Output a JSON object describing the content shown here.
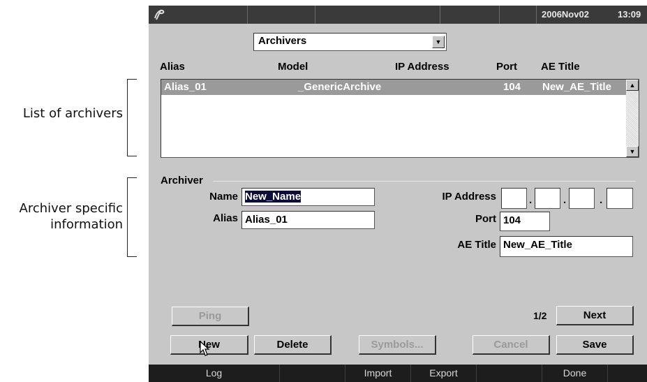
{
  "callouts": {
    "list_label": "List of archivers",
    "info_label_line1": "Archiver specific",
    "info_label_line2": "information"
  },
  "topbar": {
    "date": "2006Nov02",
    "time": "13:09",
    "logo_icon": "swirl-logo-icon"
  },
  "dropdown": {
    "selected": "Archivers"
  },
  "list": {
    "headers": [
      "Alias",
      "Model",
      "IP Address",
      "Port",
      "AE Title"
    ],
    "rows": [
      {
        "alias": "Alias_01",
        "model": "_GenericArchive",
        "ip": "",
        "port": "104",
        "ae_title": "New_AE_Title"
      }
    ]
  },
  "archiver": {
    "section_title": "Archiver",
    "name_label": "Name",
    "name_value": "New_Name",
    "alias_label": "Alias",
    "alias_value": "Alias_01",
    "ip_label": "IP Address",
    "port_label": "Port",
    "port_value": "104",
    "ae_label": "AE Title",
    "ae_value": "New_AE_Title"
  },
  "buttons": {
    "ping": "Ping",
    "page": "1/2",
    "next": "Next",
    "new": "New",
    "delete": "Delete",
    "symbols": "Symbols...",
    "cancel": "Cancel",
    "save": "Save"
  },
  "bottombar": [
    "Log",
    "",
    "Import",
    "Export",
    "",
    "Done"
  ],
  "colors": {
    "screen_bg": "#c7c7c7",
    "selection": "#9a9a9a",
    "bar": "#1d1d1d"
  }
}
